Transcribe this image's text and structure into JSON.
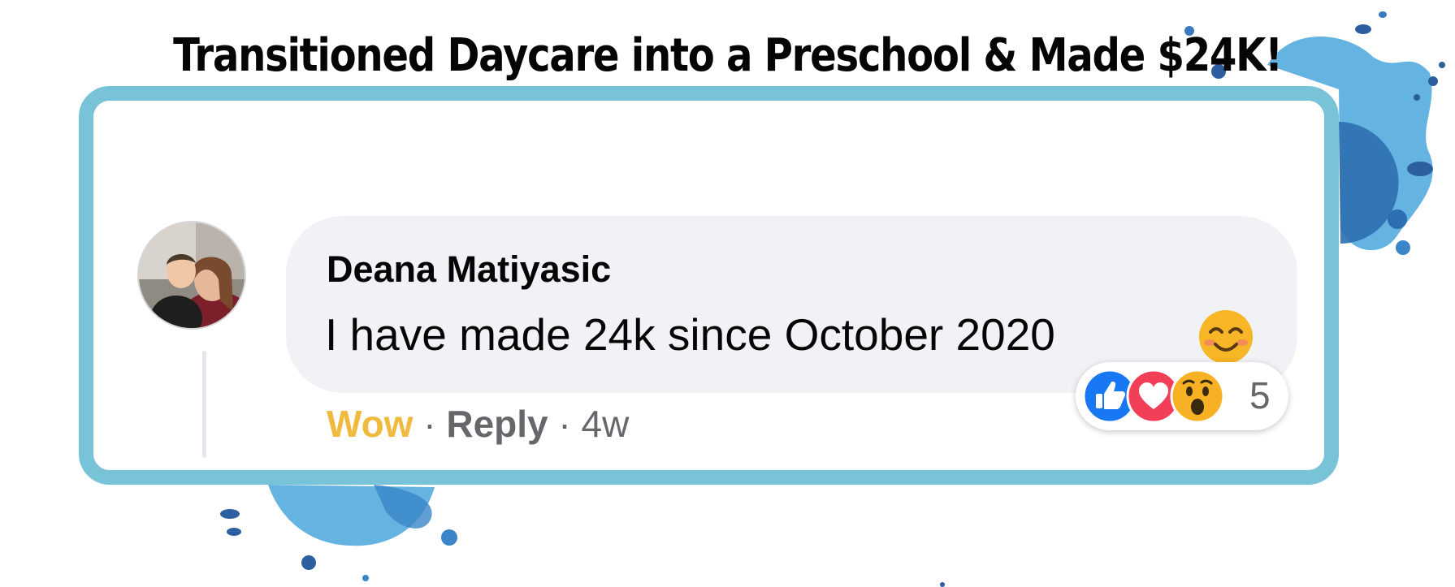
{
  "headline": "Transitioned Daycare into a Preschool & Made $24K!",
  "comment": {
    "author": "Deana Matiyasic",
    "text": "I have made 24k since October 2020",
    "emoji": "smiling-face-icon",
    "actions": {
      "wow": "Wow",
      "separator": "·",
      "reply": "Reply",
      "age": "4w"
    },
    "reactions": {
      "icons": [
        "like-icon",
        "love-icon",
        "wow-icon"
      ],
      "count": "5"
    }
  },
  "colors": {
    "frame": "#78c3d8",
    "splash": "#4aa6dc",
    "bubble": "#f0f2f5",
    "wow_text": "#f0ba3e",
    "meta_text": "#65676b",
    "like": "#1877f2",
    "love": "#f33e58",
    "wow": "#f7b125"
  }
}
